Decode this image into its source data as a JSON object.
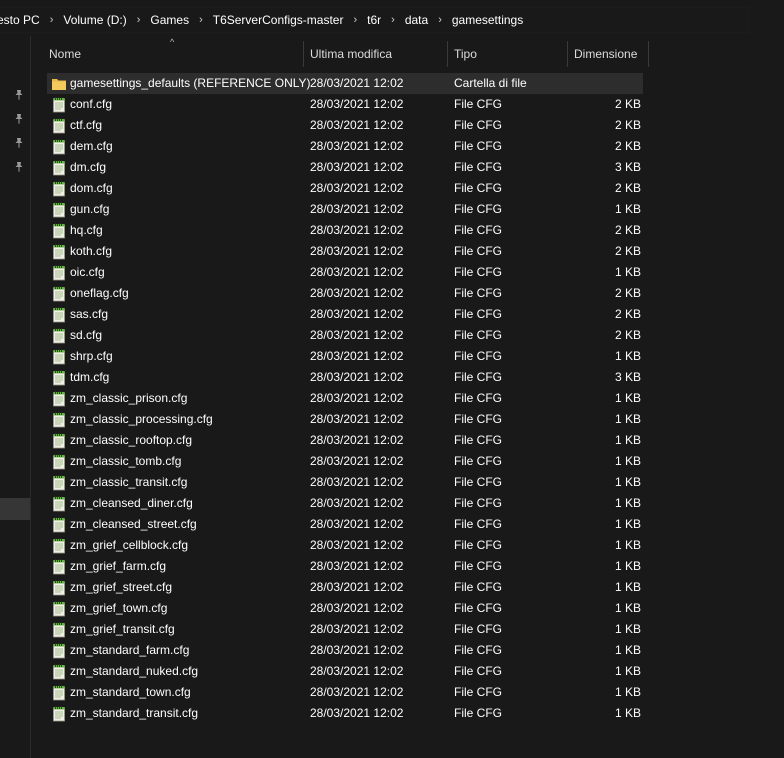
{
  "breadcrumb": [
    "esto PC",
    "Volume (D:)",
    "Games",
    "T6ServerConfigs-master",
    "t6r",
    "data",
    "gamesettings"
  ],
  "columns": {
    "name": "Nome",
    "date": "Ultima modifica",
    "type": "Tipo",
    "size": "Dimensione"
  },
  "colors": {
    "folder": "#e8b84a",
    "cfg_icon_green": "#6ab04c",
    "selected_row": "#2d2d2d"
  },
  "files": [
    {
      "name": "gamesettings_defaults (REFERENCE ONLY)",
      "date": "28/03/2021 12:02",
      "type": "Cartella di file",
      "size": "",
      "icon": "folder-icon"
    },
    {
      "name": "conf.cfg",
      "date": "28/03/2021 12:02",
      "type": "File CFG",
      "size": "2 KB",
      "icon": "cfg-file-icon"
    },
    {
      "name": "ctf.cfg",
      "date": "28/03/2021 12:02",
      "type": "File CFG",
      "size": "2 KB",
      "icon": "cfg-file-icon"
    },
    {
      "name": "dem.cfg",
      "date": "28/03/2021 12:02",
      "type": "File CFG",
      "size": "2 KB",
      "icon": "cfg-file-icon"
    },
    {
      "name": "dm.cfg",
      "date": "28/03/2021 12:02",
      "type": "File CFG",
      "size": "3 KB",
      "icon": "cfg-file-icon"
    },
    {
      "name": "dom.cfg",
      "date": "28/03/2021 12:02",
      "type": "File CFG",
      "size": "2 KB",
      "icon": "cfg-file-icon"
    },
    {
      "name": "gun.cfg",
      "date": "28/03/2021 12:02",
      "type": "File CFG",
      "size": "1 KB",
      "icon": "cfg-file-icon"
    },
    {
      "name": "hq.cfg",
      "date": "28/03/2021 12:02",
      "type": "File CFG",
      "size": "2 KB",
      "icon": "cfg-file-icon"
    },
    {
      "name": "koth.cfg",
      "date": "28/03/2021 12:02",
      "type": "File CFG",
      "size": "2 KB",
      "icon": "cfg-file-icon"
    },
    {
      "name": "oic.cfg",
      "date": "28/03/2021 12:02",
      "type": "File CFG",
      "size": "1 KB",
      "icon": "cfg-file-icon"
    },
    {
      "name": "oneflag.cfg",
      "date": "28/03/2021 12:02",
      "type": "File CFG",
      "size": "2 KB",
      "icon": "cfg-file-icon"
    },
    {
      "name": "sas.cfg",
      "date": "28/03/2021 12:02",
      "type": "File CFG",
      "size": "2 KB",
      "icon": "cfg-file-icon"
    },
    {
      "name": "sd.cfg",
      "date": "28/03/2021 12:02",
      "type": "File CFG",
      "size": "2 KB",
      "icon": "cfg-file-icon"
    },
    {
      "name": "shrp.cfg",
      "date": "28/03/2021 12:02",
      "type": "File CFG",
      "size": "1 KB",
      "icon": "cfg-file-icon"
    },
    {
      "name": "tdm.cfg",
      "date": "28/03/2021 12:02",
      "type": "File CFG",
      "size": "3 KB",
      "icon": "cfg-file-icon"
    },
    {
      "name": "zm_classic_prison.cfg",
      "date": "28/03/2021 12:02",
      "type": "File CFG",
      "size": "1 KB",
      "icon": "cfg-file-icon"
    },
    {
      "name": "zm_classic_processing.cfg",
      "date": "28/03/2021 12:02",
      "type": "File CFG",
      "size": "1 KB",
      "icon": "cfg-file-icon"
    },
    {
      "name": "zm_classic_rooftop.cfg",
      "date": "28/03/2021 12:02",
      "type": "File CFG",
      "size": "1 KB",
      "icon": "cfg-file-icon"
    },
    {
      "name": "zm_classic_tomb.cfg",
      "date": "28/03/2021 12:02",
      "type": "File CFG",
      "size": "1 KB",
      "icon": "cfg-file-icon"
    },
    {
      "name": "zm_classic_transit.cfg",
      "date": "28/03/2021 12:02",
      "type": "File CFG",
      "size": "1 KB",
      "icon": "cfg-file-icon"
    },
    {
      "name": "zm_cleansed_diner.cfg",
      "date": "28/03/2021 12:02",
      "type": "File CFG",
      "size": "1 KB",
      "icon": "cfg-file-icon"
    },
    {
      "name": "zm_cleansed_street.cfg",
      "date": "28/03/2021 12:02",
      "type": "File CFG",
      "size": "1 KB",
      "icon": "cfg-file-icon"
    },
    {
      "name": "zm_grief_cellblock.cfg",
      "date": "28/03/2021 12:02",
      "type": "File CFG",
      "size": "1 KB",
      "icon": "cfg-file-icon"
    },
    {
      "name": "zm_grief_farm.cfg",
      "date": "28/03/2021 12:02",
      "type": "File CFG",
      "size": "1 KB",
      "icon": "cfg-file-icon"
    },
    {
      "name": "zm_grief_street.cfg",
      "date": "28/03/2021 12:02",
      "type": "File CFG",
      "size": "1 KB",
      "icon": "cfg-file-icon"
    },
    {
      "name": "zm_grief_town.cfg",
      "date": "28/03/2021 12:02",
      "type": "File CFG",
      "size": "1 KB",
      "icon": "cfg-file-icon"
    },
    {
      "name": "zm_grief_transit.cfg",
      "date": "28/03/2021 12:02",
      "type": "File CFG",
      "size": "1 KB",
      "icon": "cfg-file-icon"
    },
    {
      "name": "zm_standard_farm.cfg",
      "date": "28/03/2021 12:02",
      "type": "File CFG",
      "size": "1 KB",
      "icon": "cfg-file-icon"
    },
    {
      "name": "zm_standard_nuked.cfg",
      "date": "28/03/2021 12:02",
      "type": "File CFG",
      "size": "1 KB",
      "icon": "cfg-file-icon"
    },
    {
      "name": "zm_standard_town.cfg",
      "date": "28/03/2021 12:02",
      "type": "File CFG",
      "size": "1 KB",
      "icon": "cfg-file-icon"
    },
    {
      "name": "zm_standard_transit.cfg",
      "date": "28/03/2021 12:02",
      "type": "File CFG",
      "size": "1 KB",
      "icon": "cfg-file-icon"
    }
  ]
}
